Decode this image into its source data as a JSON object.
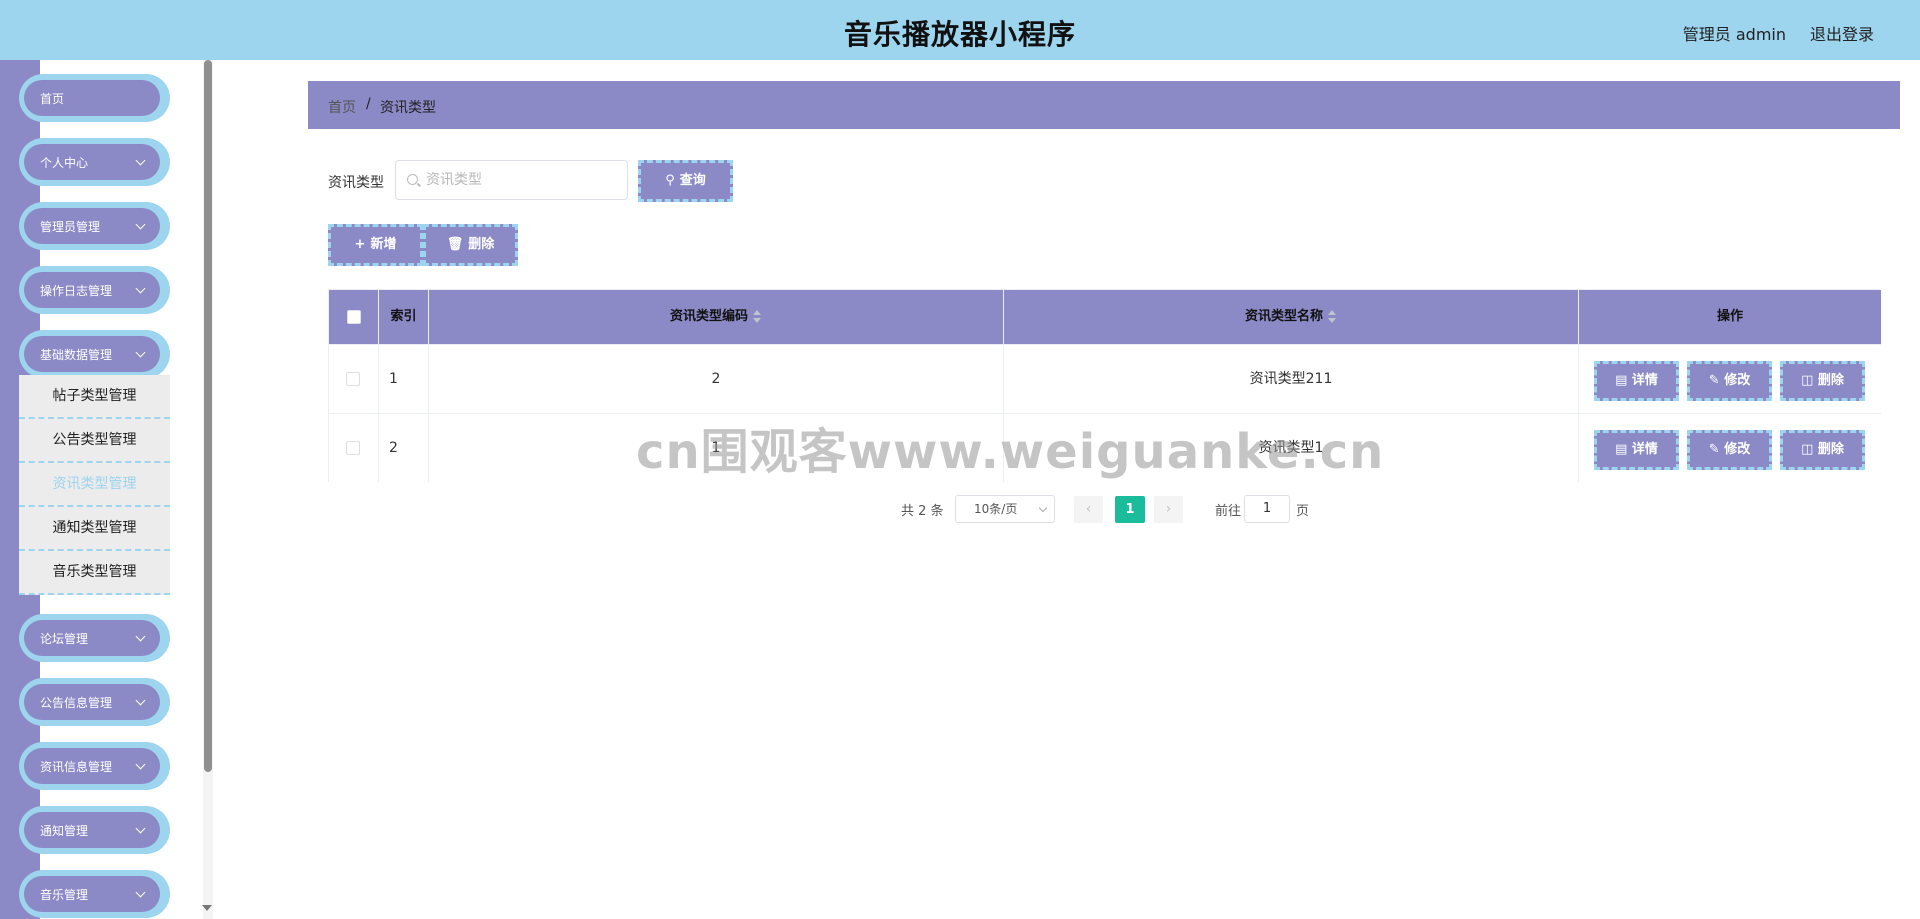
{
  "header": {
    "title": "音乐播放器小程序",
    "user_label": "管理员 admin",
    "logout_label": "退出登录"
  },
  "colors": {
    "header_bg": "#9dd4ee",
    "accent": "#8b89c6",
    "active_page": "#1abc9c"
  },
  "sidebar": {
    "items": [
      {
        "label": "首页",
        "has_children": false
      },
      {
        "label": "个人中心",
        "has_children": true
      },
      {
        "label": "管理员管理",
        "has_children": true
      },
      {
        "label": "操作日志管理",
        "has_children": true
      },
      {
        "label": "基础数据管理",
        "has_children": true
      },
      {
        "label": "论坛管理",
        "has_children": true
      },
      {
        "label": "公告信息管理",
        "has_children": true
      },
      {
        "label": "资讯信息管理",
        "has_children": true
      },
      {
        "label": "通知管理",
        "has_children": true
      },
      {
        "label": "音乐管理",
        "has_children": true
      }
    ],
    "submenu": [
      {
        "label": "帖子类型管理",
        "active": false
      },
      {
        "label": "公告类型管理",
        "active": false
      },
      {
        "label": "资讯类型管理",
        "active": true
      },
      {
        "label": "通知类型管理",
        "active": false
      },
      {
        "label": "音乐类型管理",
        "active": false
      }
    ]
  },
  "breadcrumb": {
    "home": "首页",
    "separator": "/",
    "current": "资讯类型"
  },
  "search": {
    "label": "资讯类型",
    "placeholder": "资讯类型",
    "value": "",
    "query_button": "查询"
  },
  "toolbar": {
    "add_label": "新增",
    "delete_label": "删除"
  },
  "table": {
    "columns": [
      "索引",
      "资讯类型编码",
      "资讯类型名称",
      "操作"
    ],
    "rows": [
      {
        "index": "1",
        "code": "2",
        "name": "资讯类型211"
      },
      {
        "index": "2",
        "code": "1",
        "name": "资讯类型1"
      }
    ],
    "actions": {
      "detail": "详情",
      "edit": "修改",
      "delete": "删除"
    }
  },
  "pagination": {
    "total_text": "共 2 条",
    "page_size": "10条/页",
    "current_page": "1",
    "goto_label": "前往",
    "goto_value": "1",
    "goto_suffix": "页",
    "prev_icon": "‹",
    "next_icon": "›"
  },
  "watermark": "cn围观客www.weiguanke.cn"
}
